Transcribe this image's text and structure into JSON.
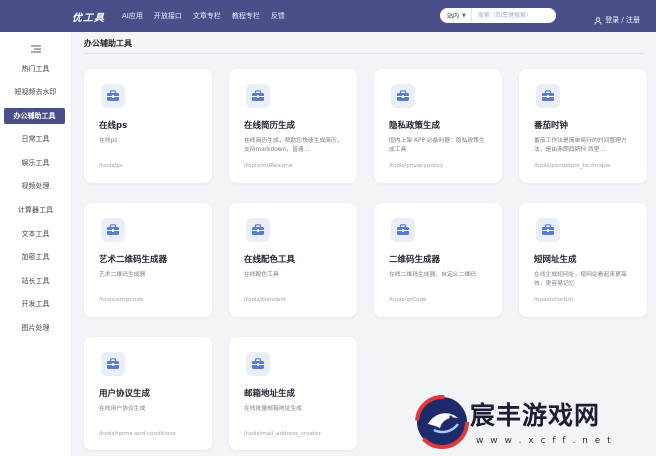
{
  "header": {
    "logo": "优工具",
    "nav": [
      "AI应用",
      "开放接口",
      "文章专栏",
      "教程专栏",
      "反馈"
    ],
    "search_scope": "站内",
    "search_placeholder": "搜索（回车键搜索）",
    "login": "登录 / 注册"
  },
  "sidebar": {
    "items": [
      "热门工具",
      "短视频去水印",
      "办公辅助工具",
      "日常工具",
      "娱乐工具",
      "视频处理",
      "计算器工具",
      "文本工具",
      "加密工具",
      "站长工具",
      "开发工具",
      "图片处理"
    ],
    "active_index": 2
  },
  "main": {
    "title": "办公辅助工具",
    "cards": [
      {
        "title": "在线ps",
        "desc": "在线ps",
        "path": "/tools/ps"
      },
      {
        "title": "在线简历生成",
        "desc": "在线简历生成，帮助您快速生成简历，支持markdown，普通…",
        "path": "/tools/mdResume"
      },
      {
        "title": "隐私政策生成",
        "desc": "国内上架 APP 必备利器：隐私政策生成工具",
        "path": "/tools/privacypolicy"
      },
      {
        "title": "番茄时钟",
        "desc": "番茄工作法是简单易行的时间管理方法，是由弗朗西斯科·西里…",
        "path": "/tools/pomodoro_technique"
      },
      {
        "title": "艺术二维码生成器",
        "desc": "艺术二维码生成器",
        "path": "/tools/artqrcode"
      },
      {
        "title": "在线配色工具",
        "desc": "在线配色工具",
        "path": "/tools/blendent"
      },
      {
        "title": "二维码生成器",
        "desc": "在线二维码生成器，自定义二维码",
        "path": "/tools/qrCode"
      },
      {
        "title": "短网址生成",
        "desc": "在线生成短网址，使网站看起来更高效，更容易记忆",
        "path": "/tools/shortUrl"
      },
      {
        "title": "用户协议生成",
        "desc": "在线用户协议生成",
        "path": "/tools/terms-and-conditions"
      },
      {
        "title": "邮箱地址生成",
        "desc": "在线批量邮箱地址生成",
        "path": "/tools/mail_address_creator"
      }
    ]
  },
  "watermark": {
    "brand": "宸丰游戏网",
    "url": "w w w . x c f f . n e t"
  },
  "colors": {
    "topbar": "#4a4f8a",
    "active": "#4a4f8a",
    "page_bg": "#f3f4f8",
    "icon_tint": "#e9eef9",
    "icon_fg": "#5b7bd5"
  }
}
